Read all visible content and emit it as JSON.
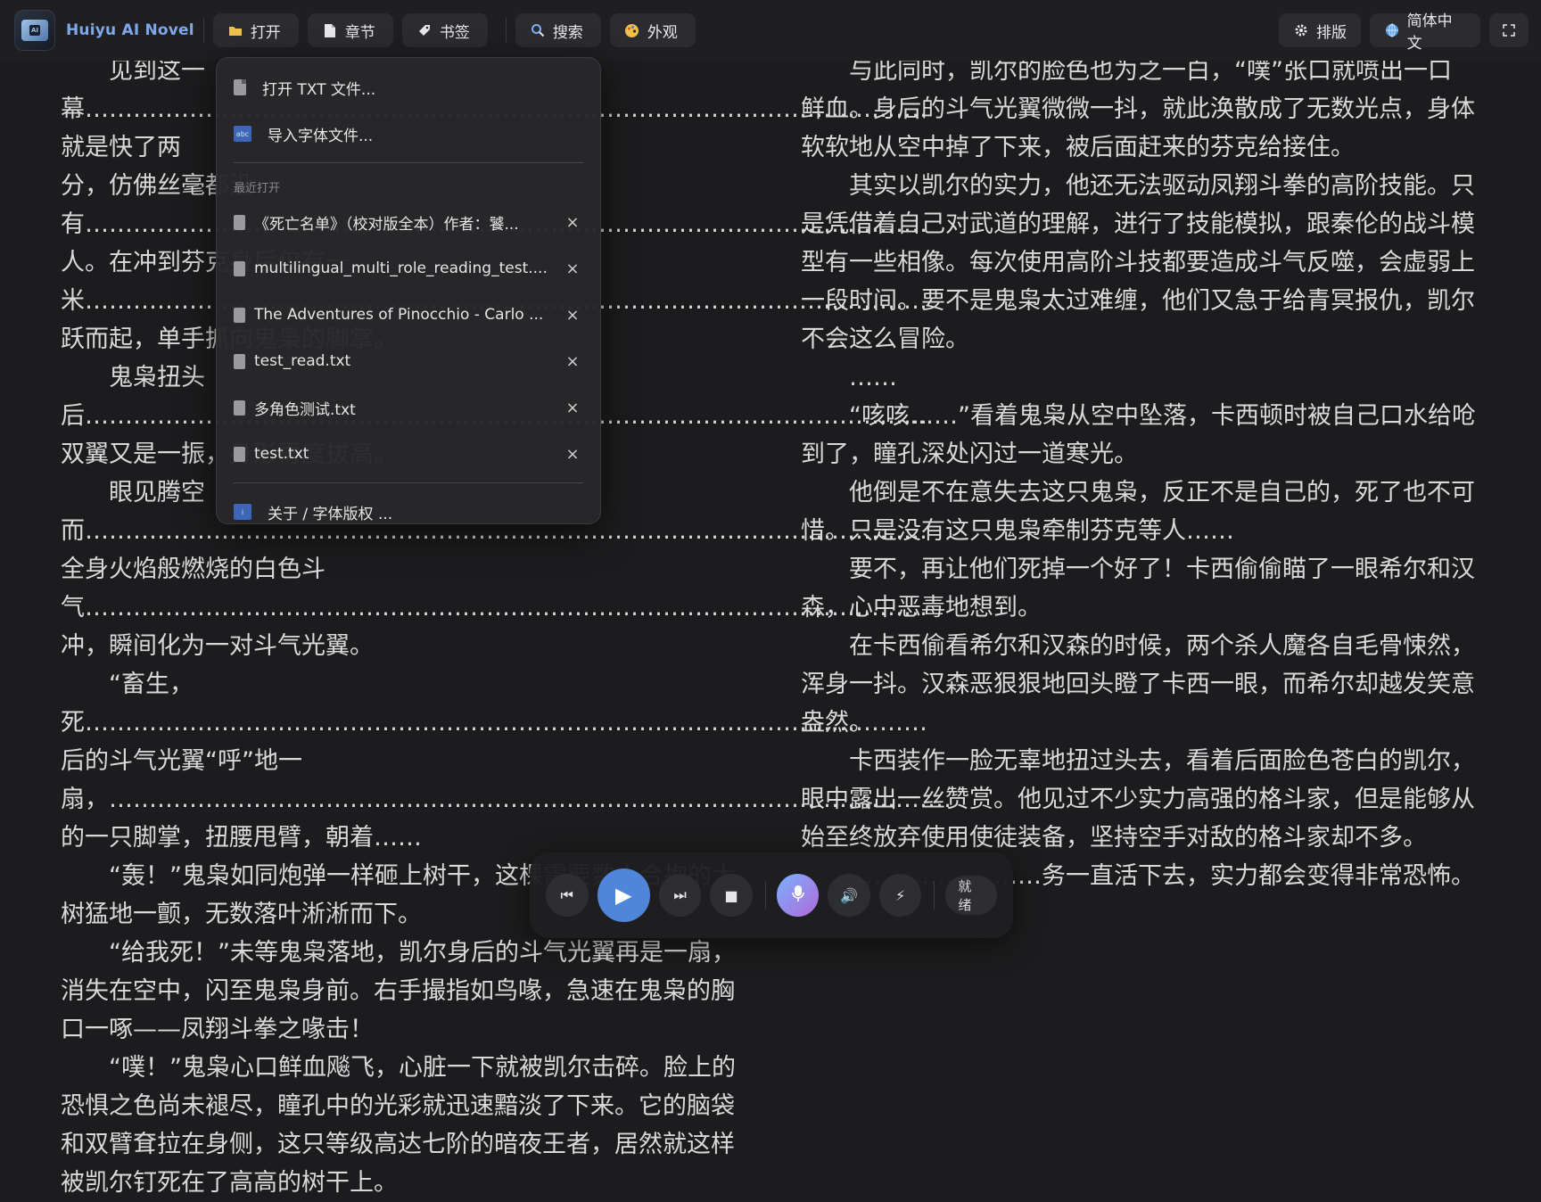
{
  "app": {
    "title": "Huiyu AI Novel",
    "logo_text": "AI"
  },
  "toolbar": {
    "left": [
      {
        "key": "open",
        "label": "打开",
        "icon": "folder-icon"
      },
      {
        "key": "chapter",
        "label": "章节",
        "icon": "document-icon"
      },
      {
        "key": "bookmark",
        "label": "书签",
        "icon": "tag-icon"
      },
      {
        "key": "search",
        "label": "搜索",
        "icon": "search-icon"
      },
      {
        "key": "appearance",
        "label": "外观",
        "icon": "palette-icon"
      }
    ],
    "right": [
      {
        "key": "layout",
        "label": "排版",
        "icon": "gear-icon"
      },
      {
        "key": "language",
        "label": "简体中文",
        "icon": "globe-icon"
      },
      {
        "key": "fullscreen",
        "label": "",
        "icon": "fullscreen-icon"
      }
    ]
  },
  "menu": {
    "open_txt": "打开 TXT 文件...",
    "import_font": "导入字体文件...",
    "import_font_icon_text": "abc",
    "recent_header": "最近打开",
    "recent": [
      "《死亡名单》（校对版全本）作者：饕...",
      "multilingual_multi_role_reading_test....",
      "The Adventures of Pinocchio - Carlo ...",
      "test_read.txt",
      "多角色测试.txt",
      "test.txt"
    ],
    "remove_symbol": "×",
    "about": "关于 / 字体版权 ...",
    "about_icon_text": "i"
  },
  "reader": {
    "left": [
      {
        "indent": true,
        "text": "见到这一幕……………………………………………………………………………………………就是快了两"
      },
      {
        "indent": false,
        "text": "分，仿佛丝毫都没有……………………………………………………………………………………………人。在冲到芬克身后仅有一米……………………………………………………………………………………………跃而起，单手抓向鬼枭的脚掌。"
      },
      {
        "indent": true,
        "text": "鬼枭扭头后……………………………………………………………………………………………双翼又是一振，身形再度拔高。"
      },
      {
        "indent": true,
        "text": "眼见腾空而……………………………………………………………………………………………全身火焰般燃烧的白色斗气……………………………………………………………………………………………冲，瞬间化为一对斗气光翼。"
      },
      {
        "indent": true,
        "text": "“畜生，死……………………………………………………………………………………………后的斗气光翼“呼”地一扇，……………………………………………………………………………………………的一只脚掌，扭腰甩臂，朝着……"
      },
      {
        "indent": true,
        "text": "“轰！”鬼枭如同炮弹一样砸上树干，这棵需要数人合抱的大树猛地一颤，无数落叶淅淅而下。"
      },
      {
        "indent": true,
        "text": "“给我死！”未等鬼枭落地，凯尔身后的斗气光翼再是一扇，消失在空中，闪至鬼枭身前。右手撮指如鸟喙，急速在鬼枭的胸口一啄——凤翔斗拳之喙击！"
      },
      {
        "indent": true,
        "text": "“噗！”鬼枭心口鲜血飚飞，心脏一下就被凯尔击碎。脸上的恐惧之色尚未褪尽，瞳孔中的光彩就迅速黯淡了下来。它的脑袋和双臂耷拉在身侧，这只等级高达七阶的暗夜王者，居然就这样被凯尔钉死在了高高的树干上。"
      }
    ],
    "right": [
      {
        "indent": true,
        "text": "与此同时，凯尔的脸色也为之一白，“噗”张口就喷出一口"
      },
      {
        "indent": false,
        "text": "鲜血。身后的斗气光翼微微一抖，就此涣散成了无数光点，身体软软地从空中掉了下来，被后面赶来的芬克给接住。"
      },
      {
        "indent": true,
        "text": "其实以凯尔的实力，他还无法驱动凤翔斗拳的高阶技能。只是凭借着自己对武道的理解，进行了技能模拟，跟秦伦的战斗模型有一些相像。每次使用高阶斗技都要造成斗气反噬，会虚弱上一段时间。要不是鬼枭太过难缠，他们又急于给青冥报仇，凯尔不会这么冒险。"
      },
      {
        "indent": true,
        "text": "……"
      },
      {
        "indent": true,
        "text": "“咳咳……”看着鬼枭从空中坠落，卡西顿时被自己口水给呛到了，瞳孔深处闪过一道寒光。"
      },
      {
        "indent": true,
        "text": "他倒是不在意失去这只鬼枭，反正不是自己的，死了也不可惜。只是没有这只鬼枭牵制芬克等人……"
      },
      {
        "indent": true,
        "text": "要不，再让他们死掉一个好了！卡西偷偷瞄了一眼希尔和汉森，心中恶毒地想到。"
      },
      {
        "indent": true,
        "text": "在卡西偷看希尔和汉森的时候，两个杀人魔各自毛骨悚然，浑身一抖。汉森恶狠狠地回头瞪了卡西一眼，而希尔却越发笑意盎然。"
      },
      {
        "indent": true,
        "text": "卡西装作一脸无辜地扭过头去，看着后面脸色苍白的凯尔，眼中露出一丝赞赏。他见过不少实力高强的格斗家，但是能够从始至终放弃使用使徒装备，坚持空手对敌的格斗家却不多。"
      },
      {
        "indent": true,
        "text": "……………………务一直活下去，实力都会变得非常恐怖。"
      }
    ]
  },
  "player": {
    "prev_icon": "⏮",
    "play_icon": "▶",
    "next_icon": "⏭",
    "stop_icon": "■",
    "volume_icon": "🔊",
    "speed_icon": "⚡",
    "status": "就绪"
  },
  "colors": {
    "accent": "#4f86d9",
    "background": "#1c1c1e",
    "menu_bg": "#28282a"
  }
}
